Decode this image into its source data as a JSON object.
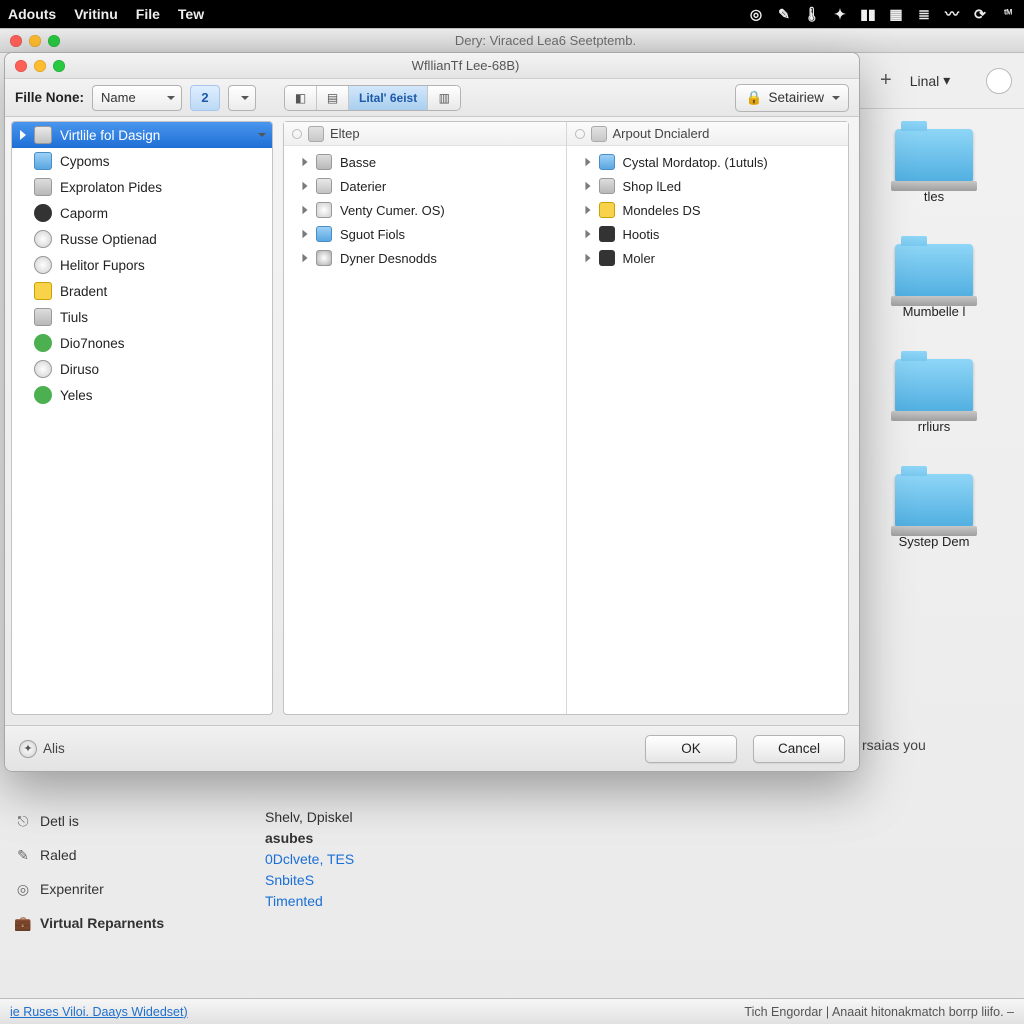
{
  "menubar": {
    "items": [
      "Adouts",
      "Vritinu",
      "File",
      "Tew"
    ]
  },
  "parent_window": {
    "title": "Dery: Viraced Lea6 Seetptemb.",
    "toolbar": {
      "plus": "+",
      "dropdown": "Linal"
    },
    "folders": [
      "tles",
      "Mumbelle l",
      "rrliurs",
      "Systep Dem"
    ],
    "info_text": "rsaias you"
  },
  "parent_sidebar": {
    "items": [
      {
        "label": "Detl is",
        "bold": false
      },
      {
        "label": "Raled",
        "bold": false
      },
      {
        "label": "Expenriter",
        "bold": false
      },
      {
        "label": "Virtual Reparnents",
        "bold": true
      }
    ]
  },
  "mid_notes": {
    "l1": "Shelv, Dpiskel",
    "l2": "asubes",
    "l3": "0Dclvete, TES",
    "l4": "SnbiteS",
    "l5": "Timented"
  },
  "statusbar": {
    "left": "ie Ruses Viloi. Daays Widedset)",
    "right": "Tich Engordar  |  Anaait hitonakmatch borrp liifo.   –"
  },
  "dialog": {
    "title": "WfllianTf Lee-68B)",
    "toolbar": {
      "label": "Fille None:",
      "name_select": "Name",
      "num_btn": "2",
      "seg_mid_label": "Lital' 6eist",
      "detail_btn": "Setairiew"
    },
    "sidebar": [
      {
        "label": "Virtlile fol Dasign",
        "icon": "ic-drive",
        "selected": true,
        "expand": true
      },
      {
        "label": "Cypoms",
        "icon": "ic-blue"
      },
      {
        "label": "Exprolaton Pides",
        "icon": "ic-gray"
      },
      {
        "label": "Caporm",
        "icon": "ic-dark"
      },
      {
        "label": "Russe Optienad",
        "icon": "ic-globe"
      },
      {
        "label": "Helitor Fupors",
        "icon": "ic-globe"
      },
      {
        "label": "Bradent",
        "icon": "ic-warn"
      },
      {
        "label": "Tiuls",
        "icon": "ic-gray"
      },
      {
        "label": "Dio7nones",
        "icon": "ic-x"
      },
      {
        "label": "Diruso",
        "icon": "ic-globe"
      },
      {
        "label": "Yeles",
        "icon": "ic-x"
      }
    ],
    "panes": [
      {
        "header": "Eltep",
        "rows": [
          {
            "label": "Basse",
            "icon": "ic-gray"
          },
          {
            "label": "Daterier",
            "icon": "ic-drive"
          },
          {
            "label": "Venty Cumer. OS)",
            "icon": "ic-globe"
          },
          {
            "label": "Sguot Fiols",
            "icon": "ic-blue"
          },
          {
            "label": "Dyner Desnodds",
            "icon": "ic-cd"
          }
        ]
      },
      {
        "header": "Arpout Dncialerd",
        "rows": [
          {
            "label": "Cystal Mordatop. (1utuls)",
            "icon": "ic-blue"
          },
          {
            "label": "Shop lLed",
            "icon": "ic-gray"
          },
          {
            "label": "Mondeles DS",
            "icon": "ic-warn"
          },
          {
            "label": "Hootis",
            "icon": "ic-dark"
          },
          {
            "label": "Moler",
            "icon": "ic-dark"
          }
        ]
      }
    ],
    "footer": {
      "left_label": "Alis",
      "ok": "OK",
      "cancel": "Cancel"
    }
  }
}
